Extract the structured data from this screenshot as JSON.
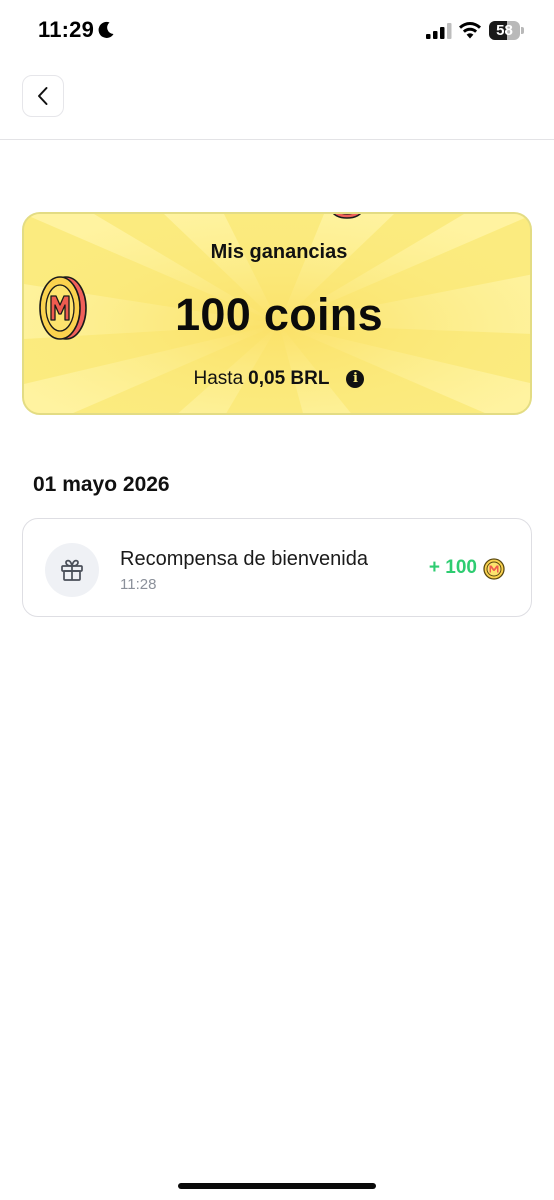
{
  "status_bar": {
    "time": "11:29",
    "battery_level": "58",
    "battery_fraction": 0.58,
    "icons": [
      "moon-icon",
      "signal-icon",
      "wifi-icon",
      "battery-icon"
    ]
  },
  "header": {
    "back_icon": "chevron-left-icon"
  },
  "earnings": {
    "title": "Mis ganancias",
    "amount": "100 coins",
    "sub_prefix": "Hasta",
    "sub_value": "0,05 BRL",
    "info_icon": "i",
    "colors": {
      "card_bg": "#fbeb7f",
      "card_border": "#e3dc84"
    }
  },
  "history": {
    "date": "01 mayo 2026",
    "transactions": [
      {
        "icon": "gift-icon",
        "title": "Recompensa de bienvenida",
        "time": "11:28",
        "amount": "+ 100",
        "amount_color": "#2ecc71"
      }
    ]
  }
}
